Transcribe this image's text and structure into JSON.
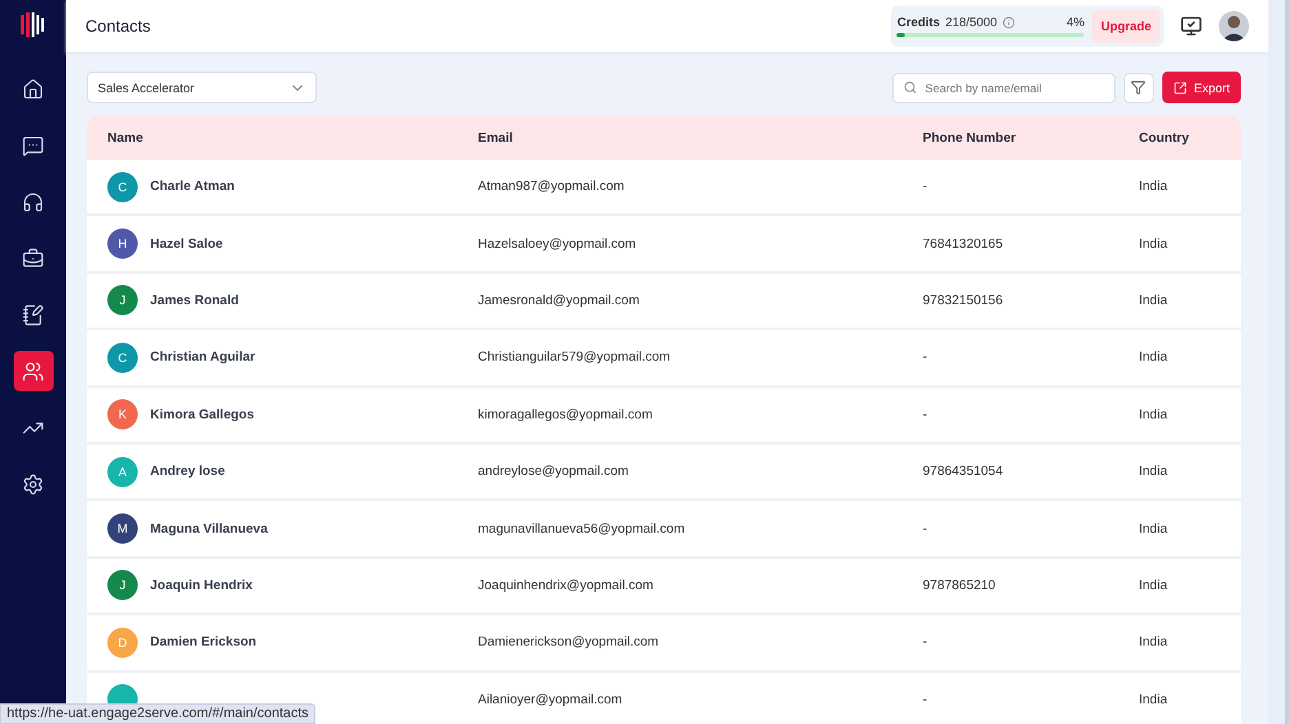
{
  "header": {
    "title": "Contacts",
    "credits": {
      "label": "Credits",
      "count": "218/5000",
      "percent": "4%",
      "level": 0.04
    },
    "upgrade": "Upgrade"
  },
  "sidebar": {
    "items": [
      {
        "kind": "home",
        "selected": false
      },
      {
        "kind": "chat",
        "selected": false
      },
      {
        "kind": "headset",
        "selected": false
      },
      {
        "kind": "agent",
        "selected": false
      },
      {
        "kind": "tasks",
        "selected": false
      },
      {
        "kind": "contacts",
        "selected": true
      },
      {
        "kind": "reports",
        "selected": false
      },
      {
        "kind": "settings",
        "selected": false
      }
    ]
  },
  "filters": {
    "list": "Sales Accelerator",
    "search": {
      "placeholder": "Search by name/email"
    },
    "export": "Export"
  },
  "table": {
    "columns": [
      "Name",
      "Email",
      "Phone Number",
      "Country"
    ],
    "rows": [
      {
        "initial": "C",
        "color": "#0e97a8",
        "name": "Charle Atman",
        "email": "Atman987@yopmail.com",
        "phone": "-",
        "country": "India"
      },
      {
        "initial": "H",
        "color": "#5059a8",
        "name": "Hazel Saloe",
        "email": "Hazelsaloey@yopmail.com",
        "phone": "76841320165",
        "country": "India"
      },
      {
        "initial": "J",
        "color": "#138a4c",
        "name": "James Ronald",
        "email": "Jamesronald@yopmail.com",
        "phone": "97832150156",
        "country": "India"
      },
      {
        "initial": "C",
        "color": "#0e97a8",
        "name": "Christian Aguilar",
        "email": "Christianguilar579@yopmail.com",
        "phone": "-",
        "country": "India"
      },
      {
        "initial": "K",
        "color": "#f2674f",
        "name": "Kimora Gallegos",
        "email": "kimoragallegos@yopmail.com",
        "phone": "-",
        "country": "India"
      },
      {
        "initial": "A",
        "color": "#17b5ac",
        "name": "Andrey lose",
        "email": "andreylose@yopmail.com",
        "phone": "97864351054",
        "country": "India"
      },
      {
        "initial": "M",
        "color": "#34427a",
        "name": "Maguna Villanueva",
        "email": "magunavillanueva56@yopmail.com",
        "phone": "-",
        "country": "India"
      },
      {
        "initial": "J",
        "color": "#138a4c",
        "name": "Joaquin Hendrix",
        "email": "Joaquinhendrix@yopmail.com",
        "phone": "9787865210",
        "country": "India"
      },
      {
        "initial": "D",
        "color": "#f9a646",
        "name": "Damien Erickson",
        "email": "Damienerickson@yopmail.com",
        "phone": "-",
        "country": "India"
      },
      {
        "color": "#17b5ac",
        "email": "Ailanioyer@yopmail.com",
        "phone": "-",
        "country": "India"
      }
    ]
  },
  "status_url": "https://he-uat.engage2serve.com/#/main/contacts"
}
